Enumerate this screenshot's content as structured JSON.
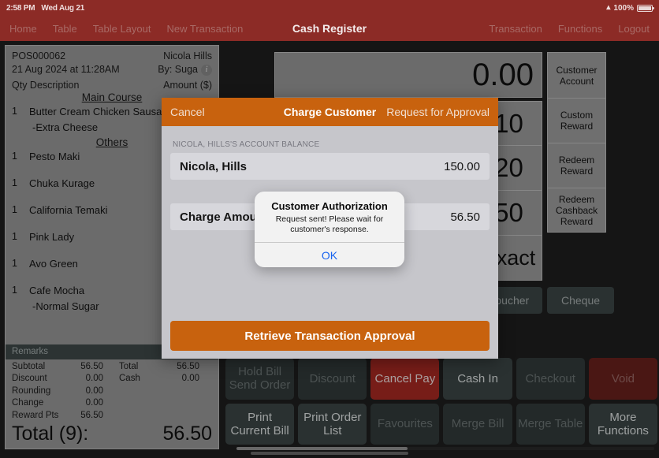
{
  "statusbar": {
    "time": "2:58 PM",
    "date": "Wed Aug 21",
    "battery_pct": "100%",
    "wifi_icon": "wifi-icon"
  },
  "navbar": {
    "title": "Cash Register",
    "left_items": [
      {
        "label": "Home"
      },
      {
        "label": "Table"
      },
      {
        "label": "Table Layout"
      },
      {
        "label": "New Transaction"
      }
    ],
    "right_items": [
      {
        "label": "Transaction"
      },
      {
        "label": "Functions"
      },
      {
        "label": "Logout"
      }
    ]
  },
  "receipt": {
    "order_no": "POS000062",
    "datetime": "21 Aug 2024 at 11:28AM",
    "customer": "Nicola Hills",
    "by": "By: Suga",
    "col_qty_desc": "Qty  Description",
    "col_amount": "Amount ($)",
    "groups": [
      {
        "category": "Main Course",
        "items": [
          {
            "qty": "1",
            "desc": "Butter Cream Chicken Sausage",
            "modifiers": [
              "-Extra Cheese"
            ]
          }
        ]
      },
      {
        "category": "Others",
        "items": [
          {
            "qty": "1",
            "desc": "Pesto Maki",
            "modifiers": []
          },
          {
            "qty": "1",
            "desc": "Chuka Kurage",
            "modifiers": []
          },
          {
            "qty": "1",
            "desc": "California Temaki",
            "modifiers": []
          },
          {
            "qty": "1",
            "desc": "Pink Lady",
            "modifiers": []
          },
          {
            "qty": "1",
            "desc": "Avo Green",
            "modifiers": []
          },
          {
            "qty": "1",
            "desc": "Cafe Mocha",
            "modifiers": [
              "-Normal Sugar"
            ]
          }
        ]
      }
    ],
    "remarks_label": "Remarks",
    "totals": [
      {
        "label": "Subtotal",
        "value": "56.50",
        "label2": "Total",
        "value2": "56.50"
      },
      {
        "label": "Discount",
        "value": "0.00",
        "label2": "Cash",
        "value2": "0.00"
      },
      {
        "label": "Rounding",
        "value": "0.00",
        "label2": "",
        "value2": ""
      },
      {
        "label": "Change",
        "value": "0.00",
        "label2": "",
        "value2": ""
      },
      {
        "label": "Reward Pts",
        "value": "56.50",
        "label2": "",
        "value2": ""
      }
    ],
    "grand_label": "Total (9):",
    "grand_value": "56.50"
  },
  "register": {
    "amount_display": "0.00",
    "quick_keys": [
      {
        "label": "10"
      },
      {
        "label": "20"
      },
      {
        "label": "50"
      },
      {
        "label": "Exact"
      }
    ],
    "pay_methods": [
      {
        "label": "Voucher"
      },
      {
        "label": "Cheque"
      }
    ],
    "right_buttons": [
      {
        "label": "Customer Account"
      },
      {
        "label": "Custom Reward"
      },
      {
        "label": "Redeem Reward"
      },
      {
        "label": "Redeem Cashback Reward"
      }
    ]
  },
  "actions": [
    {
      "label": "Hold Bill Send Order",
      "style": "dim"
    },
    {
      "label": "Discount",
      "style": "dim"
    },
    {
      "label": "Cancel Pay",
      "style": "red"
    },
    {
      "label": "Cash In",
      "style": "bright"
    },
    {
      "label": "Checkout",
      "style": "dim"
    },
    {
      "label": "Void",
      "style": "darkred"
    },
    {
      "label": "Print Current Bill",
      "style": "bright"
    },
    {
      "label": "Print Order List",
      "style": "bright"
    },
    {
      "label": "Favourites",
      "style": "dim"
    },
    {
      "label": "Merge Bill",
      "style": "dim"
    },
    {
      "label": "Merge Table",
      "style": "dim"
    },
    {
      "label": "More Functions",
      "style": "bright"
    }
  ],
  "charge_modal": {
    "cancel_label": "Cancel",
    "title": "Charge Customer",
    "request_label": "Request for Approval",
    "section_label": "NICOLA, HILLS'S ACCOUNT BALANCE",
    "balance_row": {
      "label": "Nicola, Hills",
      "value": "150.00"
    },
    "charge_row": {
      "label": "Charge Amount",
      "value": "56.50"
    },
    "footer_label": "Retrieve Transaction Approval"
  },
  "alert": {
    "title": "Customer Authorization",
    "message": "Request sent! Please wait for customer's response.",
    "ok_label": "OK"
  },
  "colors": {
    "brand_red": "#8c2b26",
    "accent_orange": "#c8620e",
    "panel_gray": "#9a9a9a",
    "action_slate": "#3d4747",
    "danger_red": "#ab2a23",
    "link_blue": "#1763ef"
  }
}
